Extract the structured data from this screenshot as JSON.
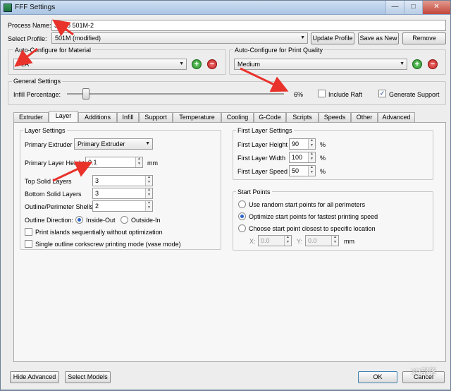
{
  "window": {
    "title": "FFF Settings",
    "minimize": "—",
    "maximize": "□",
    "close": "✕"
  },
  "process": {
    "label": "Process Name:",
    "value": "3dpro 501M-2"
  },
  "profile": {
    "label": "Select Profile:",
    "value": "501M (modified)",
    "update_button": "Update Profile",
    "save_as_new_button": "Save as New",
    "remove_button": "Remove"
  },
  "material": {
    "title": "Auto-Configure for Material",
    "value": "PLA"
  },
  "quality": {
    "title": "Auto-Configure for Print Quality",
    "value": "Medium"
  },
  "general": {
    "title": "General Settings",
    "infill_label": "Infill Percentage:",
    "infill_value": "6%",
    "infill_fraction": 0.06,
    "raft_label": "Include Raft",
    "raft_checked": false,
    "support_label": "Generate Support",
    "support_checked": true
  },
  "tabs": [
    "Extruder",
    "Layer",
    "Additions",
    "Infill",
    "Support",
    "Temperature",
    "Cooling",
    "G-Code",
    "Scripts",
    "Speeds",
    "Other",
    "Advanced"
  ],
  "active_tab": "Layer",
  "layer_settings": {
    "title": "Layer Settings",
    "primary_extruder_label": "Primary Extruder",
    "primary_extruder_value": "Primary Extruder",
    "layer_height_label": "Primary Layer Height",
    "layer_height_value": "0.1",
    "layer_height_unit": "mm",
    "top_solid_label": "Top Solid Layers",
    "top_solid_value": "3",
    "bottom_solid_label": "Bottom Solid Layers",
    "bottom_solid_value": "3",
    "outline_shells_label": "Outline/Perimeter Shells",
    "outline_shells_value": "2",
    "outline_direction_label": "Outline Direction:",
    "inside_out_label": "Inside-Out",
    "outside_in_label": "Outside-In",
    "print_islands_label": "Print islands sequentially without optimization",
    "single_outline_label": "Single outline corkscrew printing mode (vase mode)"
  },
  "first_layer": {
    "title": "First Layer Settings",
    "height_label": "First Layer Height",
    "height_value": "90",
    "width_label": "First Layer Width",
    "width_value": "100",
    "speed_label": "First Layer Speed",
    "speed_value": "50",
    "unit": "%"
  },
  "start_points": {
    "title": "Start Points",
    "option1": "Use random start points for all perimeters",
    "option2": "Optimize start points for fastest printing speed",
    "option3": "Choose start point closest to specific location",
    "x_label": "X:",
    "x_value": "0.0",
    "y_label": "Y:",
    "y_value": "0.0",
    "unit": "mm"
  },
  "footer": {
    "hide_advanced": "Hide Advanced",
    "select_models": "Select Models",
    "ok": "OK",
    "cancel": "Cancel"
  },
  "watermark": "3D部落",
  "colors": {
    "annotation_arrow": "#e8322a",
    "accent_radio": "#2a63c8"
  }
}
